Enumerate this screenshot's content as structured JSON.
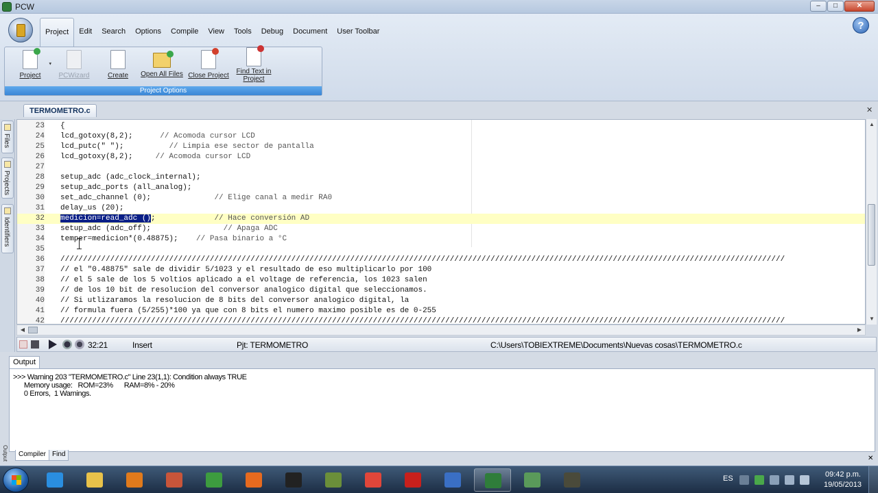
{
  "window": {
    "title": "PCW",
    "minimize_symbol": "–",
    "maximize_symbol": "□",
    "close_symbol": "✕"
  },
  "menu": {
    "tabs": [
      "Project",
      "Edit",
      "Search",
      "Options",
      "Compile",
      "View",
      "Tools",
      "Debug",
      "Document",
      "User Toolbar"
    ],
    "active": "Project",
    "help_symbol": "?"
  },
  "ribbon": {
    "group_label": "Project Options",
    "buttons": [
      {
        "label": "Project",
        "enabled": true,
        "icon": "project-icon"
      },
      {
        "label": "PCWizard",
        "enabled": false,
        "icon": "wizard-icon"
      },
      {
        "label": "Create",
        "enabled": true,
        "icon": "new-document-icon"
      },
      {
        "label": "Open All Files",
        "enabled": true,
        "icon": "open-folder-icon"
      },
      {
        "label": "Close Project",
        "enabled": true,
        "icon": "close-project-icon"
      },
      {
        "label": "Find Text in Project",
        "enabled": true,
        "icon": "find-text-icon"
      }
    ],
    "dropdown_symbol": "▾"
  },
  "editor": {
    "file_tab": "TERMOMETRO.c",
    "close_symbol": "✕",
    "side_tabs": [
      "Files",
      "Projects",
      "Identifiers"
    ],
    "current_line": 32,
    "lines": [
      {
        "n": "23",
        "code": "{"
      },
      {
        "n": "24",
        "code": "lcd_gotoxy(8,2);      // Acomoda cursor LCD"
      },
      {
        "n": "25",
        "code": "lcd_putc(\" \");          // Limpia ese sector de pantalla"
      },
      {
        "n": "26",
        "code": "lcd_gotoxy(8,2);     // Acomoda cursor LCD"
      },
      {
        "n": "27",
        "code": ""
      },
      {
        "n": "28",
        "code": "setup_adc (adc_clock_internal);"
      },
      {
        "n": "29",
        "code": "setup_adc_ports (all_analog);"
      },
      {
        "n": "30",
        "code": "set_adc_channel (0);              // Elige canal a medir RA0"
      },
      {
        "n": "31",
        "code": "delay_us (20);"
      },
      {
        "n": "32",
        "code": "medicion=read_adc ();             // Hace conversión AD",
        "selected": "medicion=read_adc ()"
      },
      {
        "n": "33",
        "code": "setup_adc (adc_off);                // Apaga ADC"
      },
      {
        "n": "34",
        "code": "temper=medicion*(0.48875);    // Pasa binario a °C"
      },
      {
        "n": "35",
        "code": ""
      },
      {
        "n": "36",
        "code": "////////////////////////////////////////////////////////////////////////////////////////////////////////////////////////////////////////////////////////////////"
      },
      {
        "n": "37",
        "code": "// el \"0.48875\" sale de dividir 5/1023 y el resultado de eso multiplicarlo por 100"
      },
      {
        "n": "38",
        "code": "// el 5 sale de los 5 voltios aplicado a el voltage de referencia, los 1023 salen"
      },
      {
        "n": "39",
        "code": "// de los 10 bit de resolucion del conversor analogico digital que seleccionamos."
      },
      {
        "n": "40",
        "code": "// Si utlizaramos la resolucion de 8 bits del conversor analogico digital, la"
      },
      {
        "n": "41",
        "code": "// formula fuera (5/255)*100 ya que con 8 bits el numero maximo posible es de 0-255"
      },
      {
        "n": "42",
        "code": "////////////////////////////////////////////////////////////////////////////////////////////////////////////////////////////////////////////////////////////////"
      }
    ]
  },
  "statusbar": {
    "position": "32:21",
    "mode": "Insert",
    "project": "Pjt: TERMOMETRO",
    "path": "C:\\Users\\TOBIEXTREME\\Documents\\Nuevas cosas\\TERMOMETRO.c"
  },
  "output": {
    "tab": "Output",
    "lines": [
      ">>> Warning 203 \"TERMOMETRO.c\" Line 23(1,1): Condition always TRUE",
      "      Memory usage:   ROM=23%      RAM=8% - 20%",
      "      0 Errors,  1 Warnings."
    ],
    "bottom_tabs": [
      "Compiler",
      "Find"
    ],
    "side_label": "Output",
    "close_symbol": "✕"
  },
  "taskbar": {
    "items": [
      {
        "name": "internet-explorer-icon",
        "color": "#2a8ee0"
      },
      {
        "name": "file-explorer-icon",
        "color": "#e8c24a"
      },
      {
        "name": "media-player-icon",
        "color": "#e07a1c"
      },
      {
        "name": "network-tool-icon",
        "color": "#c8553a"
      },
      {
        "name": "hp-icon",
        "color": "#3d9c3f"
      },
      {
        "name": "firefox-icon",
        "color": "#e66a1f"
      },
      {
        "name": "hand-cursor-app-icon",
        "color": "#222222"
      },
      {
        "name": "minecraft-icon",
        "color": "#6b8f3a"
      },
      {
        "name": "chrome-icon",
        "color": "#e1463a"
      },
      {
        "name": "acrobat-icon",
        "color": "#c8201c"
      },
      {
        "name": "chart-app-icon",
        "color": "#3a6fc4"
      },
      {
        "name": "pcw-compiler-icon",
        "color": "#2f7d3a"
      },
      {
        "name": "circuit-app-icon",
        "color": "#5a9a5a"
      },
      {
        "name": "game-app-icon",
        "color": "#4a4a3a"
      }
    ],
    "active_index": 11,
    "language": "ES",
    "time": "09:42 p.m.",
    "date": "19/05/2013"
  }
}
